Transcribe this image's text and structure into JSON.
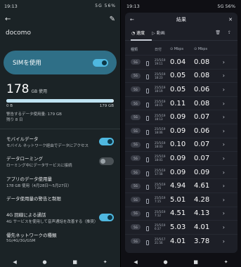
{
  "left": {
    "status": {
      "time": "19:13",
      "right": "5G 56%"
    },
    "carrier": "docomo",
    "sim": {
      "label": "SIMを使用",
      "on": true
    },
    "usage": {
      "value": "178",
      "unit": "GB 使用",
      "min": "0 B",
      "max": "179 GB",
      "fraction": 0.99
    },
    "note": [
      "警告するデータ使用量: 179 GB",
      "残り 8 日"
    ],
    "mobile_data": {
      "title": "モバイルデータ",
      "sub": "モバイル ネットワーク経由でデータにアクセス",
      "on": true
    },
    "roaming": {
      "title": "データローミング",
      "sub": "ローミング中にデータサービスに接続",
      "on": false
    },
    "app_usage": {
      "title": "アプリのデータ使用量",
      "sub": "178 GB 使用（4月28日～5月27日）"
    },
    "warn": {
      "title": "データ使用量の警告と制限"
    },
    "volte": {
      "title": "4G 回線による通話",
      "sub": "4G サービスを使用して音声通話を改善する（推奨）",
      "on": true
    },
    "pref": {
      "title": "優先ネットワークの種類",
      "sub": "5G/4G/3G/GSM"
    }
  },
  "right": {
    "status": {
      "time": "19:13",
      "right": "5G 56%"
    },
    "title": "結果",
    "tabs": [
      "速度",
      "動画"
    ],
    "headers": [
      "種類",
      "日付",
      "Mbps",
      "Mbps"
    ],
    "rows": [
      {
        "tag": "5G",
        "date": "25/5/19 19:11",
        "dl": "0.04",
        "ul": "0.08"
      },
      {
        "tag": "5G",
        "date": "25/5/19 18:23",
        "dl": "0.05",
        "ul": "0.08"
      },
      {
        "tag": "5G",
        "date": "25/5/19 18:19",
        "dl": "0.05",
        "ul": "0.06"
      },
      {
        "tag": "5G",
        "date": "25/5/19 18:15",
        "dl": "0.11",
        "ul": "0.08"
      },
      {
        "tag": "5G",
        "date": "25/5/19 18:13",
        "dl": "0.09",
        "ul": "0.07"
      },
      {
        "tag": "5G",
        "date": "25/5/19 18:06",
        "dl": "0.09",
        "ul": "0.06"
      },
      {
        "tag": "5G",
        "date": "25/5/19 18:03",
        "dl": "0.10",
        "ul": "0.07"
      },
      {
        "tag": "5G",
        "date": "25/5/19 18:01",
        "dl": "0.09",
        "ul": "0.07"
      },
      {
        "tag": "5G",
        "date": "25/5/19 17:58",
        "dl": "0.09",
        "ul": "0.09"
      },
      {
        "tag": "5G",
        "date": "25/5/19 7:26",
        "dl": "4.94",
        "ul": "4.61"
      },
      {
        "tag": "5G",
        "date": "25/5/19 7:15",
        "dl": "5.01",
        "ul": "4.28"
      },
      {
        "tag": "5G",
        "date": "25/5/19 7:12",
        "dl": "4.51",
        "ul": "4.13"
      },
      {
        "tag": "5G",
        "date": "25/5/19 6:37",
        "dl": "5.03",
        "ul": "4.01"
      },
      {
        "tag": "5G",
        "date": "25/5/17 21:56",
        "dl": "4.01",
        "ul": "3.78"
      }
    ]
  }
}
